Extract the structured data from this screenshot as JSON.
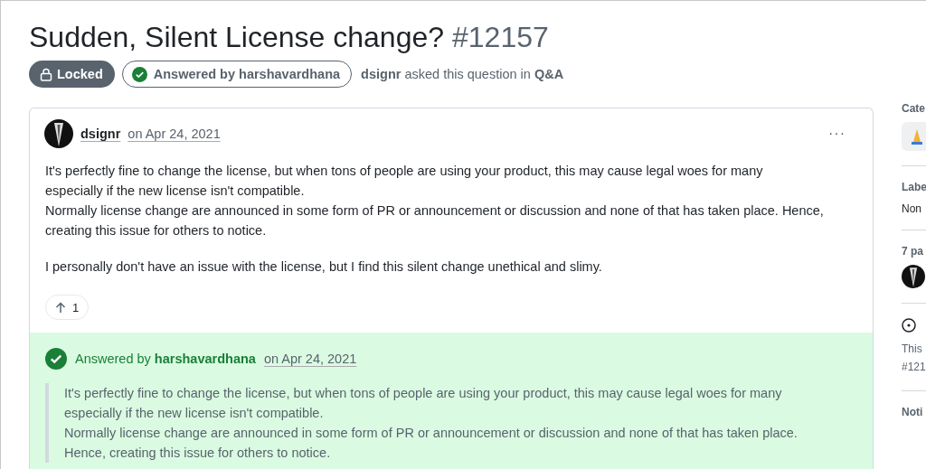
{
  "title": "Sudden, Silent License change?",
  "number": "#12157",
  "badges": [
    {
      "kind": "locked",
      "label": "Locked"
    },
    {
      "kind": "answered",
      "prefix": "Answered by",
      "user": "harshavardhana"
    }
  ],
  "meta": {
    "user": "dsignr",
    "text": "asked this question in",
    "category": "Q&A"
  },
  "question": {
    "author": "dsignr",
    "date": "on Apr 24, 2021",
    "more": "···",
    "paragraphs": [
      [
        "It's perfectly fine to change the license, but when tons of people are using your product, this may cause legal woes for many",
        "especially if the new license isn't compatible.",
        "Normally license change are announced in some form of PR or announcement or discussion and none of that has taken place. Hence,",
        "creating this issue for others to notice."
      ],
      [
        "I personally don't have an issue with the license, but I find this silent change unethical and slimy."
      ]
    ],
    "upvotes": "1"
  },
  "answer": {
    "prefix": "Answered by",
    "user": "harshavardhana",
    "date": "on Apr 24, 2021",
    "quote": [
      "It's perfectly fine to change the license, but when tons of people are using your product, this may cause legal woes for many",
      "especially if the new license isn't compatible.",
      "Normally license change are announced in some form of PR or announcement or discussion and none of that has taken place.",
      "Hence, creating this issue for others to notice."
    ]
  },
  "sidebar": {
    "category_heading": "Cate",
    "labels_heading": "Labe",
    "labels_value": "Non",
    "participants_heading": "7 pa",
    "info_lines": [
      "This",
      "#121"
    ],
    "notifications_heading": "Noti"
  }
}
